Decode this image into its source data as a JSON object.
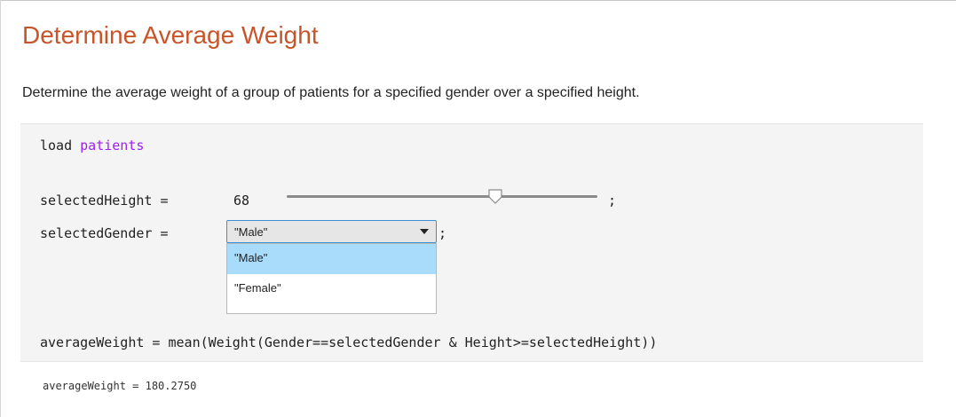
{
  "document": {
    "title": "Determine Average Weight",
    "description": "Determine the average weight of a group of patients for a specified gender over a specified height."
  },
  "code": {
    "line1_keyword": "load ",
    "line1_arg": "patients",
    "height_prefix": "selectedHeight = ",
    "height_value": "68",
    "height_semicolon": ";",
    "gender_prefix": "selectedGender = ",
    "gender_semicolon": ";",
    "avg_line": "averageWeight = mean(Weight(Gender==selectedGender & Height>=selectedHeight))"
  },
  "slider": {
    "value": 68,
    "fraction": 0.67
  },
  "dropdown": {
    "selected": "\"Male\"",
    "options": [
      "\"Male\"",
      "\"Female\""
    ],
    "highlighted_option_index": 0
  },
  "output": {
    "text": "averageWeight = 180.2750"
  },
  "colors": {
    "title": "#c8542a",
    "string_arg": "#a020f0",
    "code_background": "#f4f4f4",
    "dropdown_focus_border": "#3a8fd6",
    "option_highlight": "#a9dcfb"
  }
}
